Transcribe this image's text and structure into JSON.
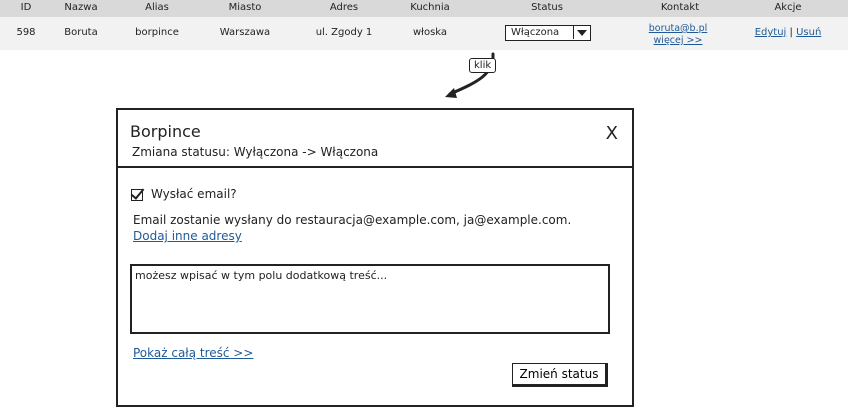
{
  "table": {
    "headers": {
      "id": "ID",
      "name": "Nazwa",
      "alias": "Alias",
      "city": "Miasto",
      "address": "Adres",
      "cuisine": "Kuchnia",
      "status": "Status",
      "contact": "Kontakt",
      "actions": "Akcje"
    },
    "row": {
      "id": "598",
      "name": "Boruta",
      "alias": "borpince",
      "city": "Warszawa",
      "address": "ul. Zgody 1",
      "cuisine": "włoska",
      "status": "Włączona",
      "contact_email": "boruta@b.pl",
      "contact_more": "więcej >>",
      "edit": "Edytuj",
      "separator": "|",
      "delete": "Usuń"
    }
  },
  "annotation": {
    "label": "klik"
  },
  "dialog": {
    "title": "Borpince",
    "subtitle": "Zmiana statusu: Wyłączona -> Włączona",
    "close": "X",
    "send_email_label": "Wysłać email?",
    "send_email_checked": true,
    "info_text": "Email zostanie wysłany do restauracja@example.com, ja@example.com.",
    "add_addresses_link": "Dodaj inne adresy",
    "message_placeholder": "możesz wpisać w tym polu dodatkową treść...",
    "show_full_link": "Pokaż całą treść >>",
    "submit_label": "Zmień status"
  }
}
